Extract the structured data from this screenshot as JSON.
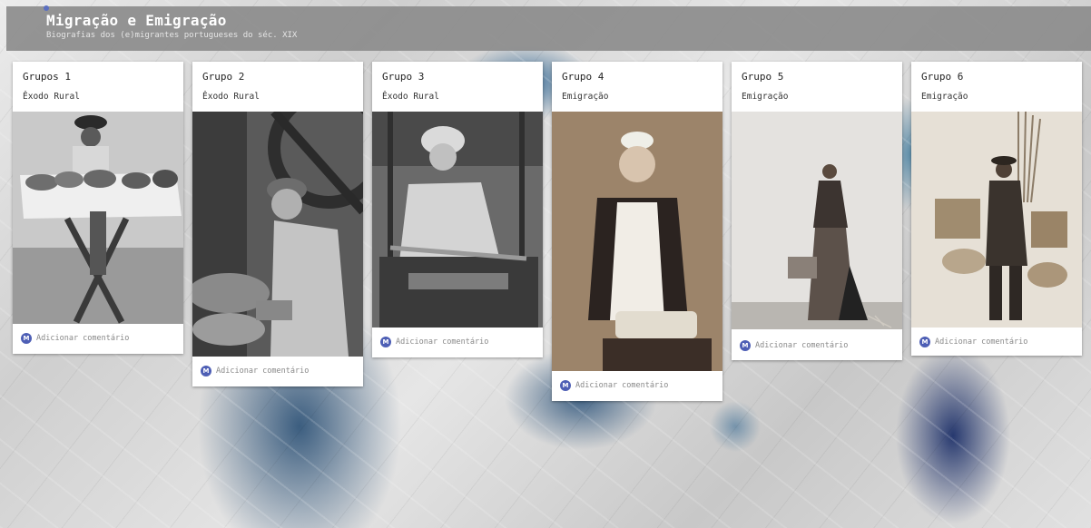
{
  "header": {
    "title": "Migração e Emigração",
    "subtitle": "Biografias dos (e)migrantes portugueses do séc. XIX"
  },
  "comment_label": "Adicionar comentário",
  "avatar_initial": "M",
  "colors": {
    "avatar": "#4e5fb5",
    "header_bg": "#8c8c8c",
    "card_bg": "#ffffff"
  },
  "cards": [
    {
      "title": "Grupos 1",
      "subtitle": "Êxodo Rural"
    },
    {
      "title": "Grupo 2",
      "subtitle": "Êxodo Rural"
    },
    {
      "title": "Grupo 3",
      "subtitle": "Êxodo Rural"
    },
    {
      "title": "Grupo 4",
      "subtitle": "Emigração"
    },
    {
      "title": "Grupo 5",
      "subtitle": "Emigração"
    },
    {
      "title": "Grupo 6",
      "subtitle": "Emigração"
    }
  ]
}
